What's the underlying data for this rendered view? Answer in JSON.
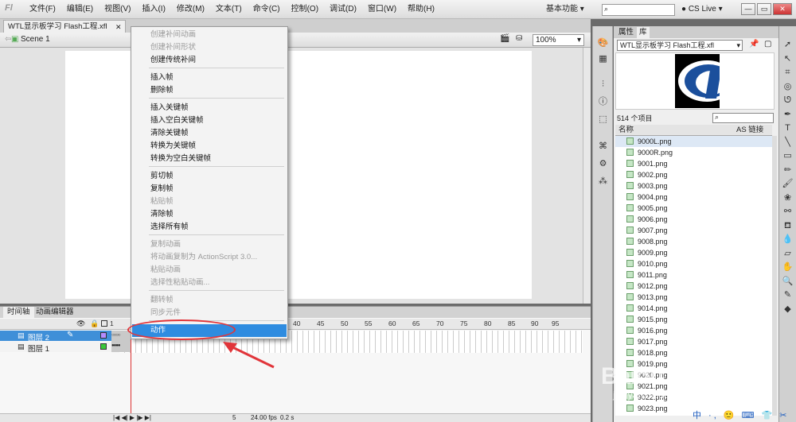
{
  "menubar": {
    "logo": "Fl",
    "items": [
      "文件(F)",
      "编辑(E)",
      "视图(V)",
      "插入(I)",
      "修改(M)",
      "文本(T)",
      "命令(C)",
      "控制(O)",
      "调试(D)",
      "窗口(W)",
      "帮助(H)"
    ],
    "workspace": "基本功能",
    "cs_live": "CS Live"
  },
  "document": {
    "tab_title": "WTL显示板学习 Flash工程.xfl",
    "scene": "Scene 1",
    "zoom": "100%"
  },
  "context_menu": {
    "items": [
      {
        "label": "创建补间动画",
        "disabled": true
      },
      {
        "label": "创建补间形状",
        "disabled": true
      },
      {
        "label": "创建传统补间",
        "disabled": false
      },
      {
        "label": "插入帧",
        "disabled": false
      },
      {
        "label": "删除帧",
        "disabled": false
      },
      {
        "label": "插入关键帧",
        "disabled": false
      },
      {
        "label": "插入空白关键帧",
        "disabled": false
      },
      {
        "label": "清除关键帧",
        "disabled": false
      },
      {
        "label": "转换为关键帧",
        "disabled": false
      },
      {
        "label": "转换为空白关键帧",
        "disabled": false
      },
      {
        "label": "剪切帧",
        "disabled": false
      },
      {
        "label": "复制帧",
        "disabled": false
      },
      {
        "label": "粘贴帧",
        "disabled": true
      },
      {
        "label": "清除帧",
        "disabled": false
      },
      {
        "label": "选择所有帧",
        "disabled": false
      },
      {
        "label": "复制动画",
        "disabled": true
      },
      {
        "label": "将动画复制为 ActionScript 3.0...",
        "disabled": true
      },
      {
        "label": "粘贴动画",
        "disabled": true
      },
      {
        "label": "选择性粘贴动画...",
        "disabled": true
      },
      {
        "label": "翻转帧",
        "disabled": true
      },
      {
        "label": "同步元件",
        "disabled": true
      }
    ],
    "highlighted": "动作"
  },
  "timeline": {
    "tabs": [
      "时间轴",
      "动画编辑器"
    ],
    "ruler": [
      "1",
      "40",
      "45",
      "50",
      "55",
      "60",
      "65",
      "70",
      "75",
      "80",
      "85",
      "90",
      "95"
    ],
    "layers": [
      "图层 2",
      "图层 1"
    ],
    "fps": "24.00 fps",
    "frame": "5",
    "time": "0.2 s"
  },
  "library": {
    "tabs": [
      "属性",
      "库"
    ],
    "file": "WTL显示板学习 Flash工程.xfl",
    "count": "514 个项目",
    "col_name": "名称",
    "col_link": "AS 链接",
    "items": [
      "9000L.png",
      "9000R.png",
      "9001.png",
      "9002.png",
      "9003.png",
      "9004.png",
      "9005.png",
      "9006.png",
      "9007.png",
      "9008.png",
      "9009.png",
      "9010.png",
      "9011.png",
      "9012.png",
      "9013.png",
      "9014.png",
      "9015.png",
      "9016.png",
      "9017.png",
      "9018.png",
      "9019.png",
      "9020.png",
      "9021.png",
      "9022.png",
      "9023.png"
    ]
  },
  "watermark": {
    "main": "Baidu 经验",
    "sub": "jingyan.baidu.com"
  },
  "ime": "中 ·, 🙂 ⌨ 👕 ✂"
}
